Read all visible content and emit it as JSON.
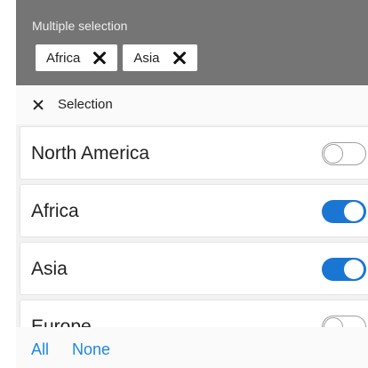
{
  "header": {
    "label": "Multiple selection",
    "chips": [
      {
        "label": "Africa",
        "remove_icon": "close-icon"
      },
      {
        "label": "Asia",
        "remove_icon": "close-icon"
      }
    ],
    "background": "#757575"
  },
  "selection_bar": {
    "close_icon": "close-icon",
    "label": "Selection"
  },
  "list": {
    "items": [
      {
        "label": "North America",
        "checked": false
      },
      {
        "label": "Africa",
        "checked": true
      },
      {
        "label": "Asia",
        "checked": true
      },
      {
        "label": "Europe",
        "checked": false
      }
    ],
    "accent": "#1976d2"
  },
  "footer": {
    "all_label": "All",
    "none_label": "None",
    "link_color": "#1e88e5"
  }
}
